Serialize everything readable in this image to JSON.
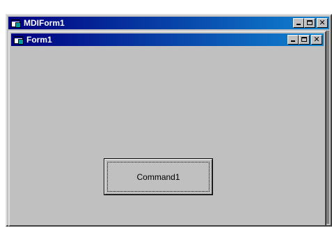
{
  "mdi_window": {
    "title": "MDIForm1",
    "icon": "form-icon",
    "buttons": [
      "minimize",
      "maximize",
      "close"
    ]
  },
  "child_window": {
    "title": "Form1",
    "icon": "form-icon",
    "buttons": [
      "minimize",
      "maximize",
      "close"
    ],
    "command_button": {
      "label": "Command1"
    }
  },
  "colors": {
    "titlebar_start": "#000080",
    "titlebar_end": "#1084d0",
    "face": "#c0c0c0",
    "mdi_client": "#808080"
  }
}
